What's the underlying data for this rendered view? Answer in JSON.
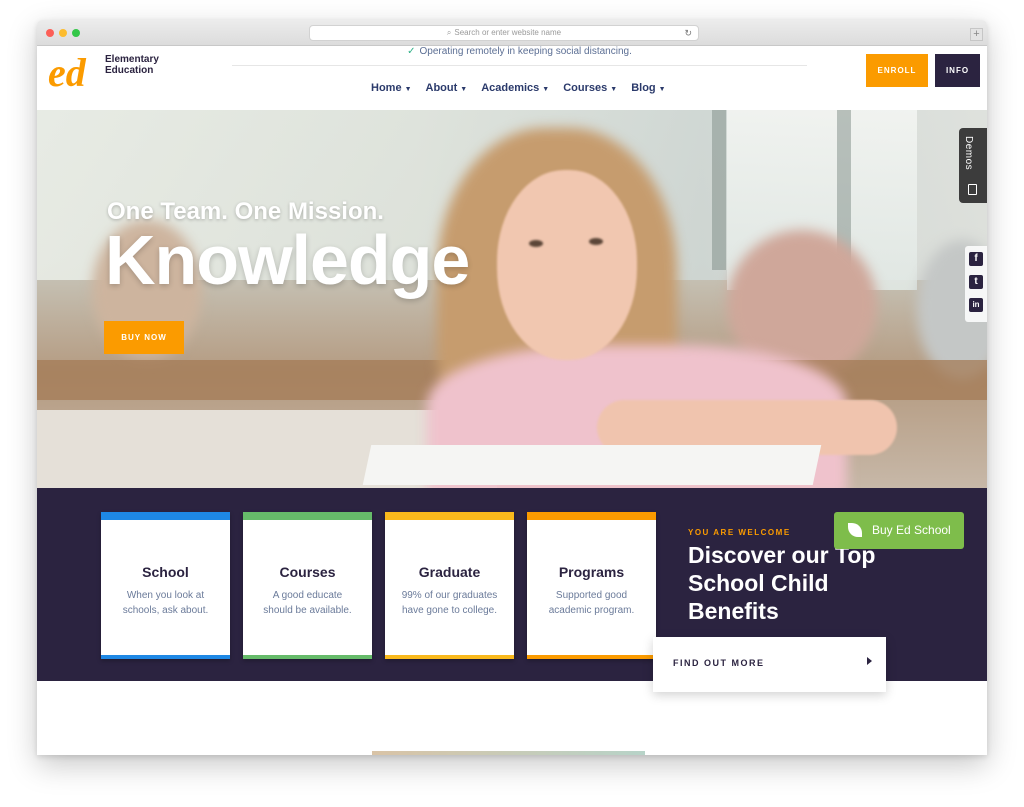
{
  "browser": {
    "url_placeholder": "Search or enter website name",
    "new_tab": "+"
  },
  "header": {
    "logo_lines": [
      "Elementary",
      "Education"
    ],
    "notice": "Operating remotely in keeping social distancing.",
    "nav": [
      {
        "label": "Home"
      },
      {
        "label": "About"
      },
      {
        "label": "Academics"
      },
      {
        "label": "Courses"
      },
      {
        "label": "Blog"
      }
    ],
    "enroll_label": "ENROLL",
    "info_label": "INFO"
  },
  "hero": {
    "subtitle": "One Team. One Mission.",
    "title": "Knowledge",
    "buy_label": "BUY NOW",
    "demos_label": "Demos",
    "social": [
      "f",
      "t",
      "in"
    ]
  },
  "features": {
    "cards": [
      {
        "title": "School",
        "body": "When you look at schools, ask about.",
        "color": "#1e88e5"
      },
      {
        "title": "Courses",
        "body": "A good educate should be available.",
        "color": "#66bb6a"
      },
      {
        "title": "Graduate",
        "body": "99% of our graduates have gone to college.",
        "color": "#f9b91c"
      },
      {
        "title": "Programs",
        "body": "Supported good academic program.",
        "color": "#fb9b00"
      }
    ],
    "welcome": "YOU ARE WELCOME",
    "heading": "Discover our Top School Child Benefits",
    "buy_ed_label": "Buy Ed School",
    "find_out_label": "FIND OUT MORE"
  },
  "colors": {
    "brand_orange": "#fb9b00",
    "brand_dark": "#2b2340",
    "buy_green": "#7ebd4b"
  }
}
